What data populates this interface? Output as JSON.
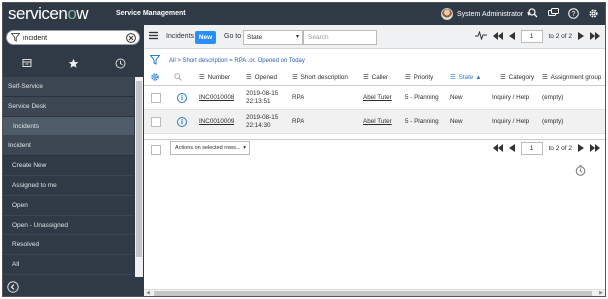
{
  "banner": {
    "logo_text": "servicenow",
    "app_title": "Service Management",
    "user_name": "System Administrator",
    "icons": [
      "search-icon",
      "chat-icon",
      "help-icon",
      "gear-icon"
    ]
  },
  "nav": {
    "filter_value": "incident",
    "tabs": [
      "all-apps-icon",
      "favorites-star-icon",
      "history-clock-icon"
    ],
    "items": [
      {
        "label": "Self-Service",
        "kind": "app"
      },
      {
        "label": "Service Desk",
        "kind": "app"
      },
      {
        "label": "Incidents",
        "kind": "active"
      },
      {
        "label": "Incident",
        "kind": "app"
      },
      {
        "label": "Create New",
        "kind": "sub"
      },
      {
        "label": "Assigned to me",
        "kind": "sub"
      },
      {
        "label": "Open",
        "kind": "sub"
      },
      {
        "label": "Open - Unassigned",
        "kind": "sub"
      },
      {
        "label": "Resolved",
        "kind": "sub"
      },
      {
        "label": "All",
        "kind": "sub"
      }
    ]
  },
  "list_header": {
    "title": "Incidents",
    "new_label": "New",
    "goto_label": "Go to",
    "goto_field": "State",
    "search_placeholder": "Search",
    "page_value": "1",
    "page_of": "to 2 of 2"
  },
  "breadcrumb": {
    "text": "All > Short description = RPA .or. Opened on Today"
  },
  "table": {
    "columns": [
      "Number",
      "Opened",
      "Short description",
      "Caller",
      "Priority",
      "State",
      "Category",
      "Assignment group"
    ],
    "sorted_column": "State",
    "rows": [
      {
        "number": "INC0010008",
        "opened_date": "2019-08-15",
        "opened_time": "22:13:51",
        "short_description": "RPA",
        "caller": "Abel Tuter",
        "priority": "5 - Planning",
        "state": "New",
        "category": "Inquiry / Help",
        "assignment_group": "(empty)"
      },
      {
        "number": "INC0010009",
        "opened_date": "2019-08-15",
        "opened_time": "22:14:30",
        "short_description": "RPA",
        "caller": "Abel Tuter",
        "priority": "5 - Planning",
        "state": "New",
        "category": "Inquiry / Help",
        "assignment_group": "(empty)"
      }
    ]
  },
  "footer": {
    "actions_label": "Actions on selected rows...",
    "page_value": "1",
    "page_of": "to 2 of 2"
  },
  "colors": {
    "banner_bg": "#303a46",
    "new_button": "#278efc",
    "link_blue": "#2b7bd4"
  }
}
